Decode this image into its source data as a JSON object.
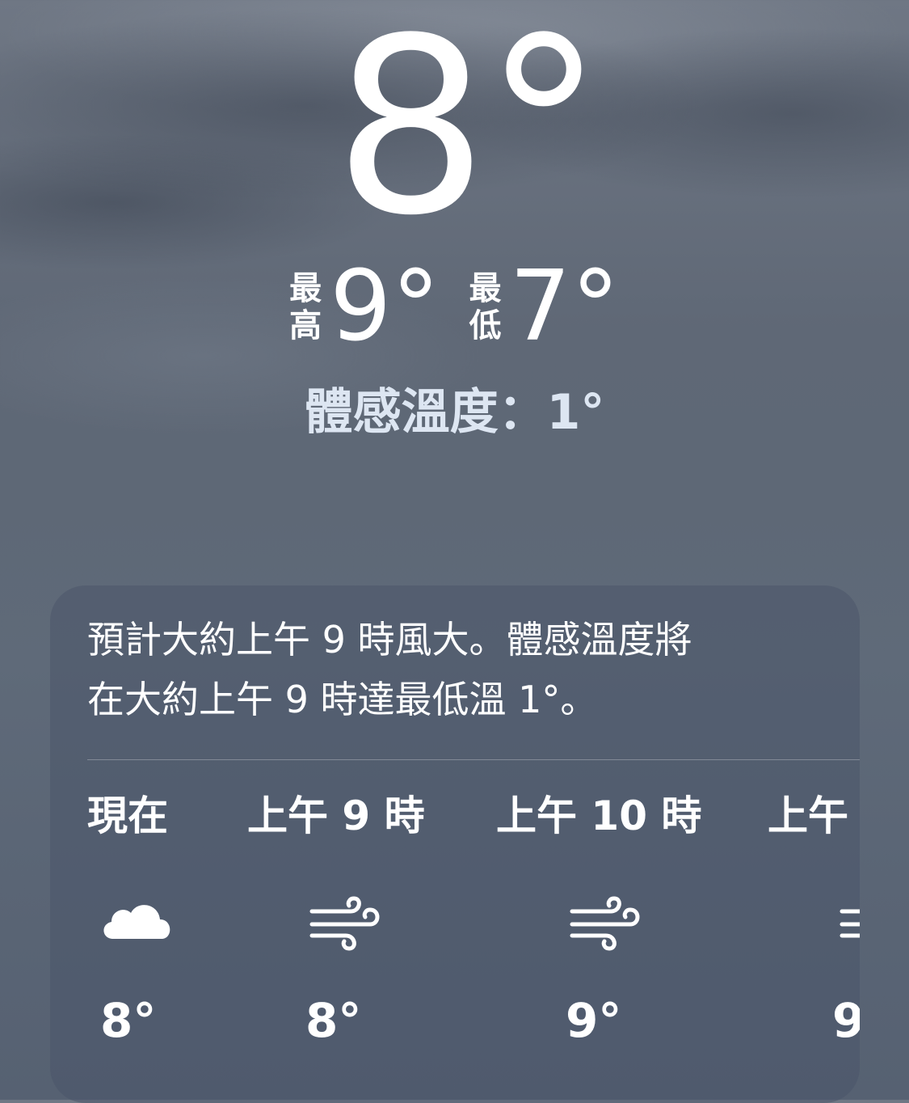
{
  "current": {
    "temperature": "8°",
    "high_label": "最高",
    "high_value": "9°",
    "low_label": "最低",
    "low_value": "7°",
    "feels_like": "體感溫度：1°"
  },
  "forecast_card": {
    "summary_line1": "預計大約上午 9 時風大。體感溫度將",
    "summary_line2": "在大約上午 9 時達最低溫 1°。",
    "hours": [
      {
        "label": "現在",
        "icon": "cloud-icon",
        "temp": "8°"
      },
      {
        "label": "上午 9 時",
        "icon": "wind-icon",
        "temp": "8°"
      },
      {
        "label": "上午 10 時",
        "icon": "wind-icon",
        "temp": "9°"
      },
      {
        "label": "上午",
        "icon": "wind-icon",
        "temp": "9"
      }
    ]
  },
  "colors": {
    "card_background": "#4a566a",
    "feels_like_text": "#dde6f2"
  }
}
